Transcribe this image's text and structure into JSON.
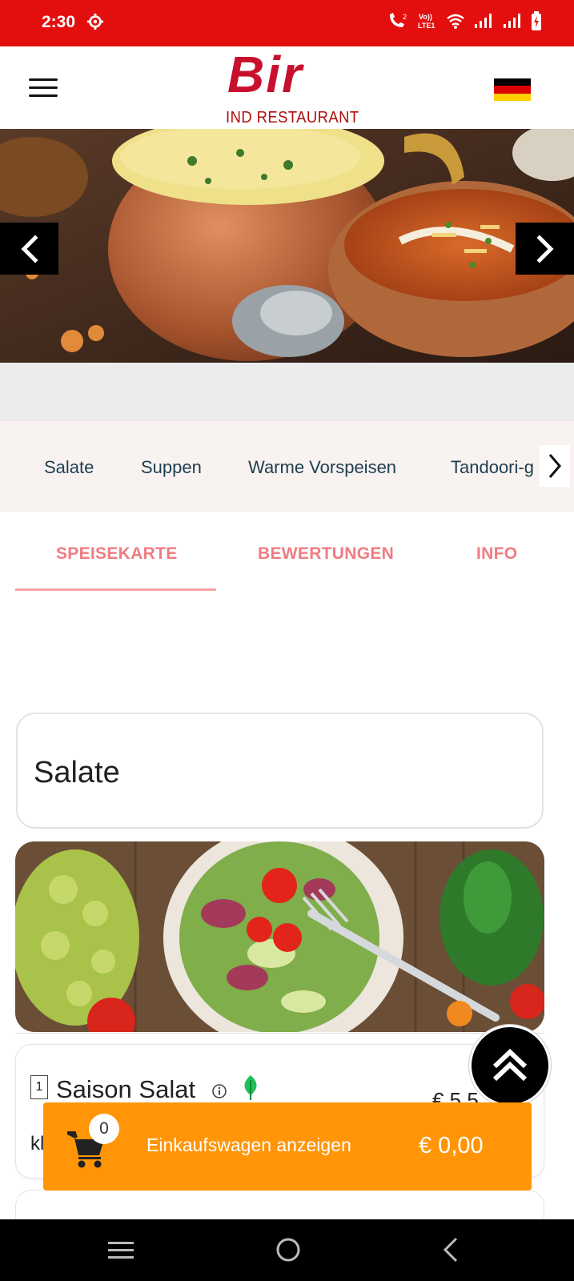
{
  "status_bar": {
    "time": "2:30",
    "icons": [
      "gear-icon",
      "wifi-call-icon",
      "volte-icon",
      "wifi-icon",
      "signal-icon",
      "signal-icon",
      "battery-charging-icon"
    ],
    "background": "#e30f0f"
  },
  "header": {
    "logo_word": "Bir",
    "logo_subtitle": "IND RESTAURANT",
    "menu_icon": "hamburger-icon",
    "language_flag": "germany-flag-icon"
  },
  "hero": {
    "prev_icon": "chevron-left-icon",
    "next_icon": "chevron-right-icon"
  },
  "categories": {
    "items": [
      "Salate",
      "Suppen",
      "Warme Vorspeisen",
      "Tandoori-g"
    ],
    "scroll_icon": "chevron-right-icon"
  },
  "tabs": {
    "items": [
      "SPEISEKARTE",
      "BEWERTUNGEN",
      "INFO"
    ],
    "active_index": 0,
    "accent": "#f07b82"
  },
  "section": {
    "title": "Salate"
  },
  "dishes": [
    {
      "number": "1",
      "name": "Saison Salat",
      "price": "€ 5,5",
      "description": "kl",
      "icons": [
        "info-icon",
        "vegetarian-leaf-icon"
      ]
    }
  ],
  "cart": {
    "count": "0",
    "label": "Einkaufswagen anzeigen",
    "total": "€ 0,00",
    "color": "#ff9507"
  },
  "scroll_top_icon": "double-chevron-up-icon",
  "nav_bar": {
    "buttons": [
      "recents-icon",
      "home-icon",
      "back-icon"
    ]
  }
}
